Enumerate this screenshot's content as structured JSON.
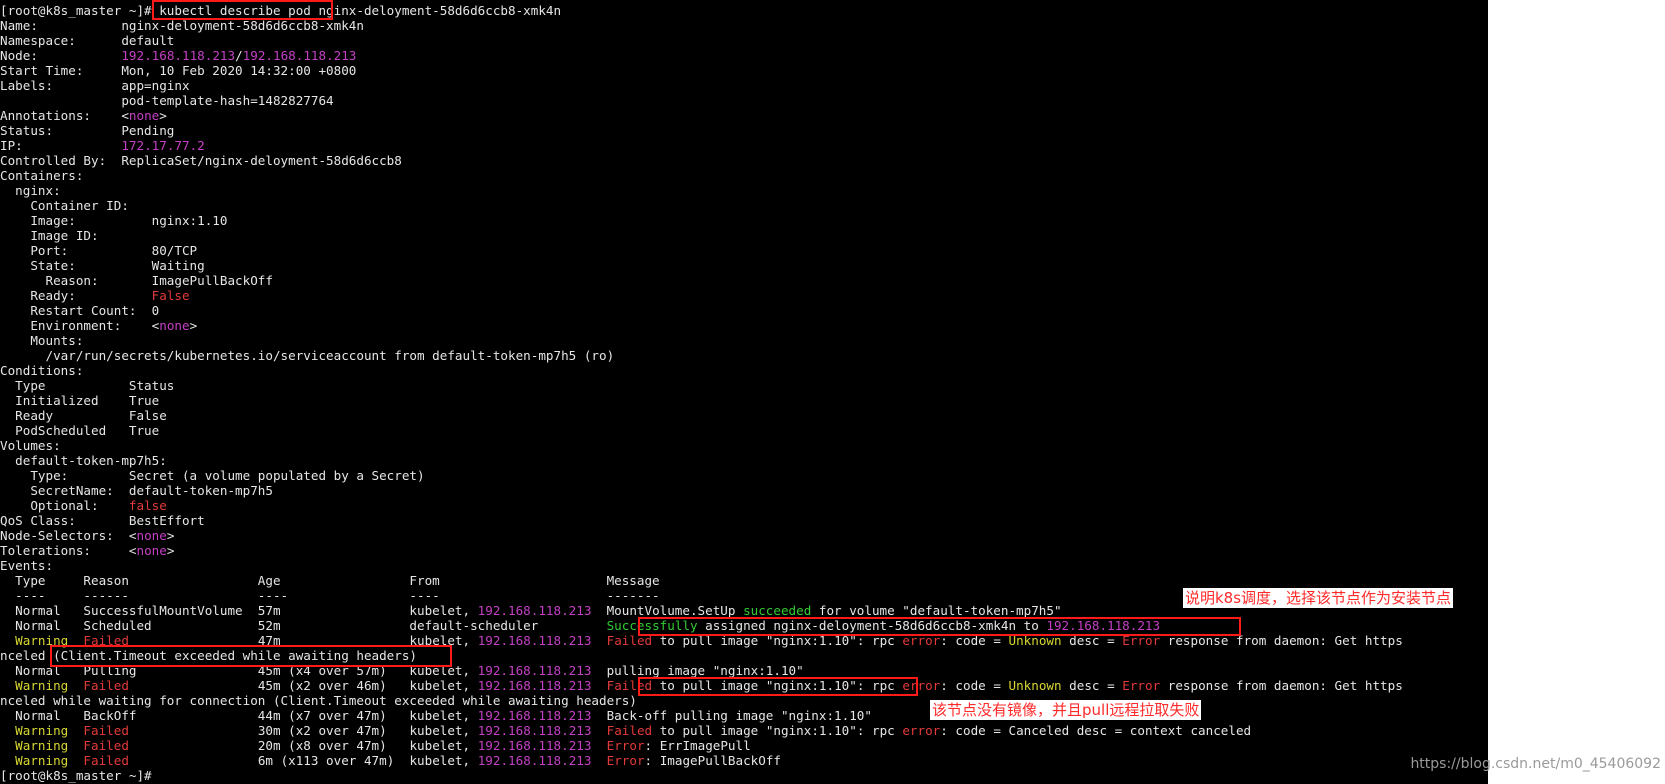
{
  "terminal": {
    "lines": [
      {
        "segments": [
          {
            "t": "[root@k8s_master ~]# kubectl describe pod nginx-deloyment-58d6d6ccb8-xmk4n",
            "c": "w"
          }
        ]
      },
      {
        "segments": [
          {
            "t": "Name:           nginx-deloyment-58d6d6ccb8-xmk4n",
            "c": "w"
          }
        ]
      },
      {
        "segments": [
          {
            "t": "Namespace:      default",
            "c": "w"
          }
        ]
      },
      {
        "segments": [
          {
            "t": "Node:           ",
            "c": "w"
          },
          {
            "t": "192.168.118.213",
            "c": "m"
          },
          {
            "t": "/",
            "c": "w"
          },
          {
            "t": "192.168.118.213",
            "c": "m"
          }
        ]
      },
      {
        "segments": [
          {
            "t": "Start Time:     Mon, 10 Feb 2020 14:32:00 +0800",
            "c": "w"
          }
        ]
      },
      {
        "segments": [
          {
            "t": "Labels:         app=nginx",
            "c": "w"
          }
        ]
      },
      {
        "segments": [
          {
            "t": "                pod-template-hash=1482827764",
            "c": "w"
          }
        ]
      },
      {
        "segments": [
          {
            "t": "Annotations:    <",
            "c": "w"
          },
          {
            "t": "none",
            "c": "m"
          },
          {
            "t": ">",
            "c": "w"
          }
        ]
      },
      {
        "segments": [
          {
            "t": "Status:         Pending",
            "c": "w"
          }
        ]
      },
      {
        "segments": [
          {
            "t": "IP:             ",
            "c": "w"
          },
          {
            "t": "172.17.77.2",
            "c": "m"
          }
        ]
      },
      {
        "segments": [
          {
            "t": "Controlled By:  ReplicaSet/nginx-deloyment-58d6d6ccb8",
            "c": "w"
          }
        ]
      },
      {
        "segments": [
          {
            "t": "Containers:",
            "c": "w"
          }
        ]
      },
      {
        "segments": [
          {
            "t": "  nginx:",
            "c": "w"
          }
        ]
      },
      {
        "segments": [
          {
            "t": "    Container ID:",
            "c": "w"
          }
        ]
      },
      {
        "segments": [
          {
            "t": "    Image:          nginx:1.10",
            "c": "w"
          }
        ]
      },
      {
        "segments": [
          {
            "t": "    Image ID:",
            "c": "w"
          }
        ]
      },
      {
        "segments": [
          {
            "t": "    Port:           80/TCP",
            "c": "w"
          }
        ]
      },
      {
        "segments": [
          {
            "t": "    State:          Waiting",
            "c": "w"
          }
        ]
      },
      {
        "segments": [
          {
            "t": "      Reason:       ImagePullBackOff",
            "c": "w"
          }
        ]
      },
      {
        "segments": [
          {
            "t": "    Ready:          ",
            "c": "w"
          },
          {
            "t": "False",
            "c": "r"
          }
        ]
      },
      {
        "segments": [
          {
            "t": "    Restart Count:  0",
            "c": "w"
          }
        ]
      },
      {
        "segments": [
          {
            "t": "    Environment:    <",
            "c": "w"
          },
          {
            "t": "none",
            "c": "m"
          },
          {
            "t": ">",
            "c": "w"
          }
        ]
      },
      {
        "segments": [
          {
            "t": "    Mounts:",
            "c": "w"
          }
        ]
      },
      {
        "segments": [
          {
            "t": "      /var/run/secrets/kubernetes.io/serviceaccount from default-token-mp7h5 (ro)",
            "c": "w"
          }
        ]
      },
      {
        "segments": [
          {
            "t": "Conditions:",
            "c": "w"
          }
        ]
      },
      {
        "segments": [
          {
            "t": "  Type           Status",
            "c": "w"
          }
        ]
      },
      {
        "segments": [
          {
            "t": "  Initialized    True",
            "c": "w"
          }
        ]
      },
      {
        "segments": [
          {
            "t": "  Ready          False",
            "c": "w"
          }
        ]
      },
      {
        "segments": [
          {
            "t": "  PodScheduled   True",
            "c": "w"
          }
        ]
      },
      {
        "segments": [
          {
            "t": "Volumes:",
            "c": "w"
          }
        ]
      },
      {
        "segments": [
          {
            "t": "  default-token-mp7h5:",
            "c": "w"
          }
        ]
      },
      {
        "segments": [
          {
            "t": "    Type:        Secret (a volume populated by a Secret)",
            "c": "w"
          }
        ]
      },
      {
        "segments": [
          {
            "t": "    SecretName:  default-token-mp7h5",
            "c": "w"
          }
        ]
      },
      {
        "segments": [
          {
            "t": "    Optional:    ",
            "c": "w"
          },
          {
            "t": "false",
            "c": "r"
          }
        ]
      },
      {
        "segments": [
          {
            "t": "QoS Class:       BestEffort",
            "c": "w"
          }
        ]
      },
      {
        "segments": [
          {
            "t": "Node-Selectors:  <",
            "c": "w"
          },
          {
            "t": "none",
            "c": "m"
          },
          {
            "t": ">",
            "c": "w"
          }
        ]
      },
      {
        "segments": [
          {
            "t": "Tolerations:     <",
            "c": "w"
          },
          {
            "t": "none",
            "c": "m"
          },
          {
            "t": ">",
            "c": "w"
          }
        ]
      },
      {
        "segments": [
          {
            "t": "Events:",
            "c": "w"
          }
        ]
      },
      {
        "segments": [
          {
            "t": "  Type     Reason                 Age                 From                      Message",
            "c": "w"
          }
        ]
      },
      {
        "segments": [
          {
            "t": "  ----     ------                 ----                ----                      -------",
            "c": "w"
          }
        ]
      },
      {
        "segments": [
          {
            "t": "  Normal   SuccessfulMountVolume  57m                 kubelet, ",
            "c": "w"
          },
          {
            "t": "192.168.118.213",
            "c": "m"
          },
          {
            "t": "  MountVolume.SetUp ",
            "c": "w"
          },
          {
            "t": "succeeded",
            "c": "g"
          },
          {
            "t": " for volume \"default-token-mp7h5\"",
            "c": "w"
          }
        ]
      },
      {
        "segments": [
          {
            "t": "  Normal   Scheduled              52m                 default-scheduler         ",
            "c": "w"
          },
          {
            "t": "Successfully",
            "c": "g"
          },
          {
            "t": " assigned nginx-deloyment-58d6d6ccb8-xmk4n to ",
            "c": "w"
          },
          {
            "t": "192.168.118.213",
            "c": "m"
          }
        ]
      },
      {
        "segments": [
          {
            "t": "  ",
            "c": "w"
          },
          {
            "t": "Warning",
            "c": "y"
          },
          {
            "t": "  ",
            "c": "w"
          },
          {
            "t": "Failed",
            "c": "r"
          },
          {
            "t": "                 47m                 kubelet, ",
            "c": "w"
          },
          {
            "t": "192.168.118.213",
            "c": "m"
          },
          {
            "t": "  ",
            "c": "w"
          },
          {
            "t": "Failed",
            "c": "r"
          },
          {
            "t": " to pull image \"nginx:1.10\": rpc ",
            "c": "w"
          },
          {
            "t": "error",
            "c": "r"
          },
          {
            "t": ": code = ",
            "c": "w"
          },
          {
            "t": "Unknown",
            "c": "y"
          },
          {
            "t": " desc = ",
            "c": "w"
          },
          {
            "t": "Error",
            "c": "r"
          },
          {
            "t": " response from daemon: Get https",
            "c": "w"
          }
        ]
      },
      {
        "segments": [
          {
            "t": "nceled (Client.Timeout exceeded while awaiting headers)",
            "c": "w"
          }
        ]
      },
      {
        "segments": [
          {
            "t": "  Normal   Pulling                45m (x4 over 57m)   kubelet, ",
            "c": "w"
          },
          {
            "t": "192.168.118.213",
            "c": "m"
          },
          {
            "t": "  pulling image \"nginx:1.10\"",
            "c": "w"
          }
        ]
      },
      {
        "segments": [
          {
            "t": "  ",
            "c": "w"
          },
          {
            "t": "Warning",
            "c": "y"
          },
          {
            "t": "  ",
            "c": "w"
          },
          {
            "t": "Failed",
            "c": "r"
          },
          {
            "t": "                 45m (x2 over 46m)   kubelet, ",
            "c": "w"
          },
          {
            "t": "192.168.118.213",
            "c": "m"
          },
          {
            "t": "  ",
            "c": "w"
          },
          {
            "t": "Failed",
            "c": "r"
          },
          {
            "t": " to pull image \"nginx:1.10\": rpc ",
            "c": "w"
          },
          {
            "t": "error",
            "c": "r"
          },
          {
            "t": ": code = ",
            "c": "w"
          },
          {
            "t": "Unknown",
            "c": "y"
          },
          {
            "t": " desc = ",
            "c": "w"
          },
          {
            "t": "Error",
            "c": "r"
          },
          {
            "t": " response from daemon: Get https",
            "c": "w"
          }
        ]
      },
      {
        "segments": [
          {
            "t": "nceled while waiting for connection (Client.Timeout exceeded while awaiting headers)",
            "c": "w"
          }
        ]
      },
      {
        "segments": [
          {
            "t": "  Normal   BackOff                44m (x7 over 47m)   kubelet, ",
            "c": "w"
          },
          {
            "t": "192.168.118.213",
            "c": "m"
          },
          {
            "t": "  Back-off pulling image \"nginx:1.10\"",
            "c": "w"
          }
        ]
      },
      {
        "segments": [
          {
            "t": "  ",
            "c": "w"
          },
          {
            "t": "Warning",
            "c": "y"
          },
          {
            "t": "  ",
            "c": "w"
          },
          {
            "t": "Failed",
            "c": "r"
          },
          {
            "t": "                 30m (x2 over 47m)   kubelet, ",
            "c": "w"
          },
          {
            "t": "192.168.118.213",
            "c": "m"
          },
          {
            "t": "  ",
            "c": "w"
          },
          {
            "t": "Failed",
            "c": "r"
          },
          {
            "t": " to pull image \"nginx:1.10\": rpc ",
            "c": "w"
          },
          {
            "t": "error",
            "c": "r"
          },
          {
            "t": ": code = Canceled desc = context canceled",
            "c": "w"
          }
        ]
      },
      {
        "segments": [
          {
            "t": "  ",
            "c": "w"
          },
          {
            "t": "Warning",
            "c": "y"
          },
          {
            "t": "  ",
            "c": "w"
          },
          {
            "t": "Failed",
            "c": "r"
          },
          {
            "t": "                 20m (x8 over 47m)   kubelet, ",
            "c": "w"
          },
          {
            "t": "192.168.118.213",
            "c": "m"
          },
          {
            "t": "  ",
            "c": "w"
          },
          {
            "t": "Error",
            "c": "r"
          },
          {
            "t": ": ErrImagePull",
            "c": "w"
          }
        ]
      },
      {
        "segments": [
          {
            "t": "  ",
            "c": "w"
          },
          {
            "t": "Warning",
            "c": "y"
          },
          {
            "t": "  ",
            "c": "w"
          },
          {
            "t": "Failed",
            "c": "r"
          },
          {
            "t": "                 6m (x113 over 47m)  kubelet, ",
            "c": "w"
          },
          {
            "t": "192.168.118.213",
            "c": "m"
          },
          {
            "t": "  ",
            "c": "w"
          },
          {
            "t": "Error",
            "c": "r"
          },
          {
            "t": ": ImagePullBackOff",
            "c": "w"
          }
        ]
      },
      {
        "segments": [
          {
            "t": "[root@k8s_master ~]# ",
            "c": "w"
          }
        ]
      }
    ]
  },
  "annotations": {
    "scheduling_note": "说明k8s调度，选择该节点作为安装节点",
    "pull_fail_note": "该节点没有镜像，并且pull远程拉取失败"
  },
  "watermark": "https://blog.csdn.net/m0_45406092",
  "colors": {
    "terminal_bg": "#000000",
    "text": "#e6e6e6",
    "magenta": "#c440c4",
    "red": "#e33a3a",
    "green": "#33cc33",
    "yellow": "#d7d733",
    "highlight_box": "#ff1a1a"
  }
}
